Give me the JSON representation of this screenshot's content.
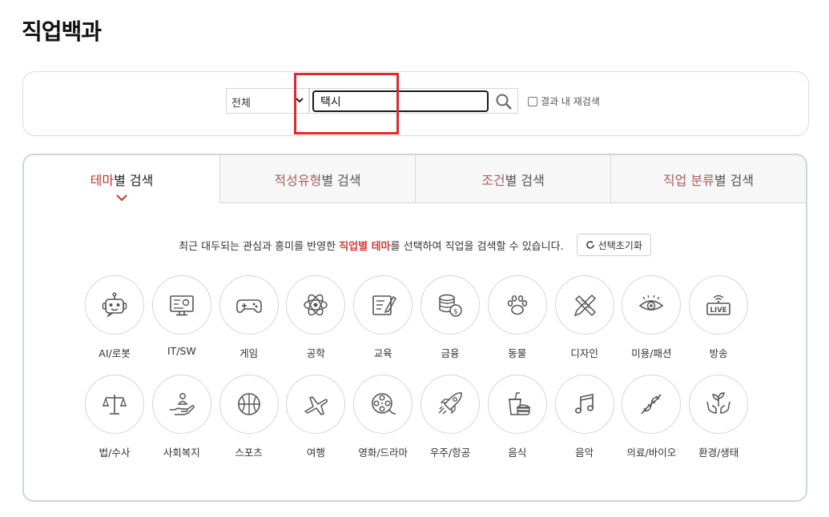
{
  "page": {
    "title": "직업백과"
  },
  "search": {
    "scope": "전체",
    "query": "택시",
    "recheck_label": "결과 내 재검색"
  },
  "tabs": [
    {
      "hl": "테마",
      "rest": "별 검색"
    },
    {
      "hl": "적성유형",
      "rest": "별 검색"
    },
    {
      "hl": "조건",
      "rest": "별 검색"
    },
    {
      "hl": "직업 분류",
      "rest": "별 검색"
    }
  ],
  "desc": {
    "pre": "최근 대두되는 관심과 흥미를 반영한",
    "accent": "직업별 테마",
    "post": "를 선택하여 직업을 검색할 수 있습니다.",
    "reset_label": "선택초기화"
  },
  "themes": [
    {
      "label": "AI/로봇",
      "icon": "robot-icon"
    },
    {
      "label": "IT/SW",
      "icon": "monitor-icon"
    },
    {
      "label": "게임",
      "icon": "gamepad-icon"
    },
    {
      "label": "공학",
      "icon": "atom-icon"
    },
    {
      "label": "교육",
      "icon": "notebook-icon"
    },
    {
      "label": "금융",
      "icon": "coins-icon"
    },
    {
      "label": "동물",
      "icon": "paw-icon"
    },
    {
      "label": "디자인",
      "icon": "pencil-ruler-icon"
    },
    {
      "label": "미용/패션",
      "icon": "eye-icon"
    },
    {
      "label": "방송",
      "icon": "live-icon"
    },
    {
      "label": "법/수사",
      "icon": "scales-icon"
    },
    {
      "label": "사회복지",
      "icon": "hand-person-icon"
    },
    {
      "label": "스포츠",
      "icon": "basketball-icon"
    },
    {
      "label": "여행",
      "icon": "airplane-icon"
    },
    {
      "label": "영화/드라마",
      "icon": "film-reel-icon"
    },
    {
      "label": "우주/항공",
      "icon": "rocket-icon"
    },
    {
      "label": "음식",
      "icon": "food-icon"
    },
    {
      "label": "음악",
      "icon": "music-note-icon"
    },
    {
      "label": "의료/바이오",
      "icon": "dna-icon"
    },
    {
      "label": "환경/생태",
      "icon": "plant-hands-icon"
    }
  ]
}
